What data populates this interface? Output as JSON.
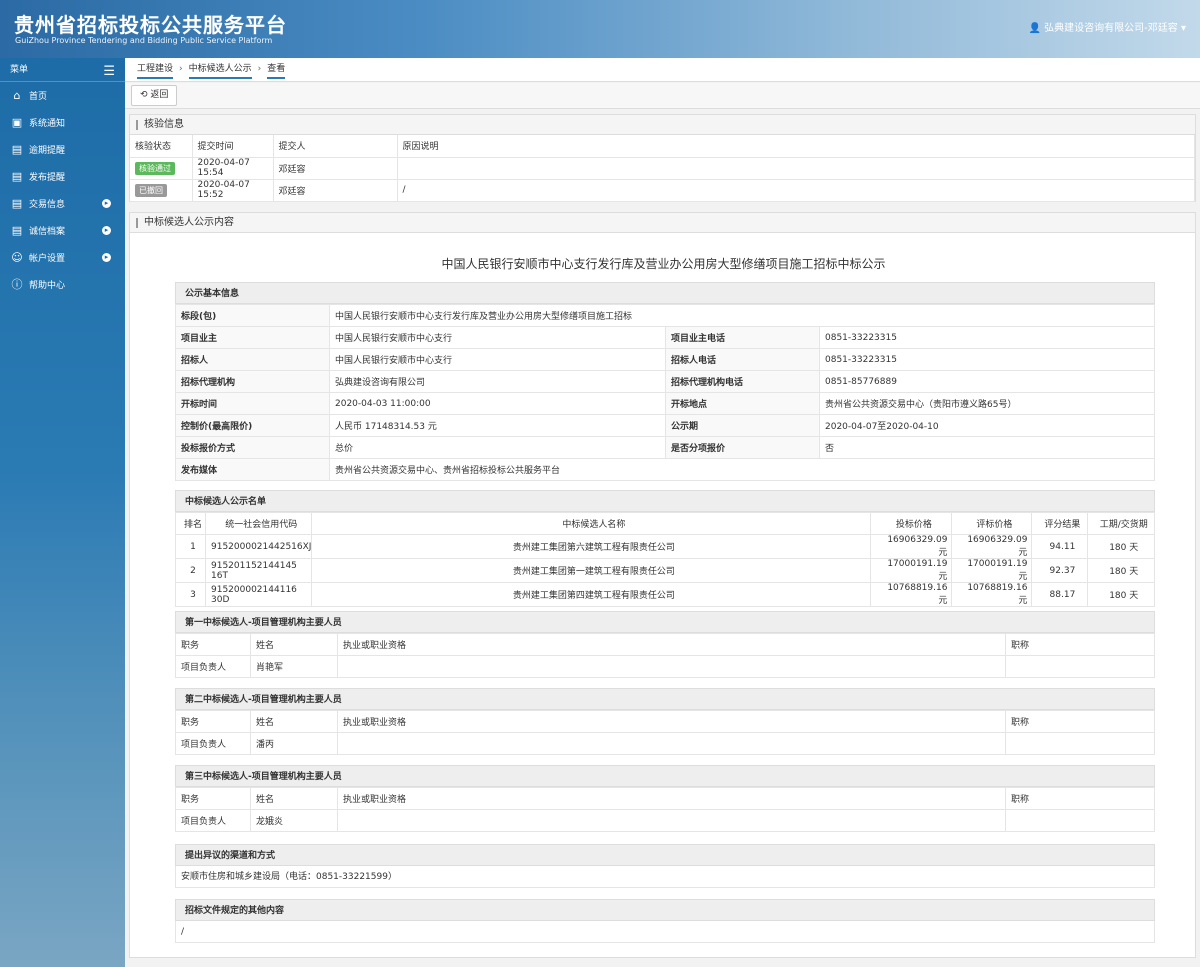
{
  "header": {
    "title": "贵州省招标投标公共服务平台",
    "subtitle": "GuiZhou Province Tendering and Bidding Public Service Platform",
    "user": "弘典建设咨询有限公司-邓廷容"
  },
  "sidebar": {
    "menu_label": "菜单",
    "items": [
      {
        "label": "首页",
        "icon": "home-icon"
      },
      {
        "label": "系统通知",
        "icon": "monitor-icon"
      },
      {
        "label": "逾期提醒",
        "icon": "list-icon"
      },
      {
        "label": "发布提醒",
        "icon": "list-icon"
      },
      {
        "label": "交易信息",
        "icon": "list-icon"
      },
      {
        "label": "诚信档案",
        "icon": "doc-icon"
      },
      {
        "label": "帐户设置",
        "icon": "user-icon"
      },
      {
        "label": "帮助中心",
        "icon": "help-icon"
      }
    ]
  },
  "breadcrumb": {
    "item1": "工程建设",
    "item2": "中标候选人公示",
    "item3": "查看"
  },
  "toolbar": {
    "back": "返回"
  },
  "verify": {
    "title": "核验信息",
    "headers": [
      "核验状态",
      "提交时间",
      "提交人",
      "原因说明"
    ],
    "rows": [
      {
        "status": "核验通过",
        "time": "2020-04-07 15:54",
        "person": "邓廷容",
        "reason": ""
      },
      {
        "status": "已撤回",
        "time": "2020-04-07 15:52",
        "person": "邓廷容",
        "reason": "/"
      }
    ]
  },
  "content": {
    "panel_title": "中标候选人公示内容",
    "title": "中国人民银行安顺市中心支行发行库及营业办公用房大型修缮项目施工招标中标公示",
    "basic": {
      "header": "公示基本信息",
      "section_k": "标段(包)",
      "section_v": "中国人民银行安顺市中心支行发行库及营业办公用房大型修缮项目施工招标",
      "owner_k": "项目业主",
      "owner_v": "中国人民银行安顺市中心支行",
      "owner_tel_k": "项目业主电话",
      "owner_tel_v": "0851-33223315",
      "tenderer_k": "招标人",
      "tenderer_v": "中国人民银行安顺市中心支行",
      "tenderer_tel_k": "招标人电话",
      "tenderer_tel_v": "0851-33223315",
      "agency_k": "招标代理机构",
      "agency_v": "弘典建设咨询有限公司",
      "agency_tel_k": "招标代理机构电话",
      "agency_tel_v": "0851-85776889",
      "open_time_k": "开标时间",
      "open_time_v": "2020-04-03 11:00:00",
      "open_place_k": "开标地点",
      "open_place_v": "贵州省公共资源交易中心（贵阳市遵义路65号）",
      "ceiling_k": "控制价(最高限价)",
      "ceiling_v": "人民币 17148314.53 元",
      "period_k": "公示期",
      "period_v": "2020-04-07至2020-04-10",
      "quote_k": "投标报价方式",
      "quote_v": "总价",
      "split_k": "是否分项报价",
      "split_v": "否",
      "media_k": "发布媒体",
      "media_v": "贵州省公共资源交易中心、贵州省招标投标公共服务平台"
    },
    "candidates": {
      "header": "中标候选人公示名单",
      "columns": [
        "排名",
        "统一社会信用代码",
        "中标候选人名称",
        "投标价格",
        "评标价格",
        "评分结果",
        "工期/交货期"
      ],
      "rows": [
        {
          "rank": "1",
          "code": "9152000021442516XJ",
          "name": "贵州建工集团第六建筑工程有限责任公司",
          "bid": "16906329.09 元",
          "eval": "16906329.09 元",
          "score": "94.11",
          "period": "180 天"
        },
        {
          "rank": "2",
          "code": "915201152144145​16T",
          "name": "贵州建工集团第一建筑工程有限责任公司",
          "bid": "17000191.19 元",
          "eval": "17000191.19 元",
          "score": "92.37",
          "period": "180 天"
        },
        {
          "rank": "3",
          "code": "915200002144116​30D",
          "name": "贵州建工集团第四建筑工程有限责任公司",
          "bid": "10768819.16 元",
          "eval": "10768819.16 元",
          "score": "88.17",
          "period": "180 天"
        }
      ]
    },
    "staff": {
      "cols": [
        "职务",
        "姓名",
        "执业或职业资格",
        "职称"
      ],
      "s1_header": "第一中标候选人-项目管理机构主要人员",
      "s1_role": "项目负责人",
      "s1_name": "肖艳军",
      "s2_header": "第二中标候选人-项目管理机构主要人员",
      "s2_role": "项目负责人",
      "s2_name": "潘丙",
      "s3_header": "第三中标候选人-项目管理机构主要人员",
      "s3_role": "项目负责人",
      "s3_name": "龙娥炎"
    },
    "objection": {
      "header": "提出异议的渠道和方式",
      "text": "安顺市住房和城乡建设局（电话：0851-33221599）"
    },
    "other": {
      "header": "招标文件规定的其他内容",
      "text": "/"
    }
  }
}
